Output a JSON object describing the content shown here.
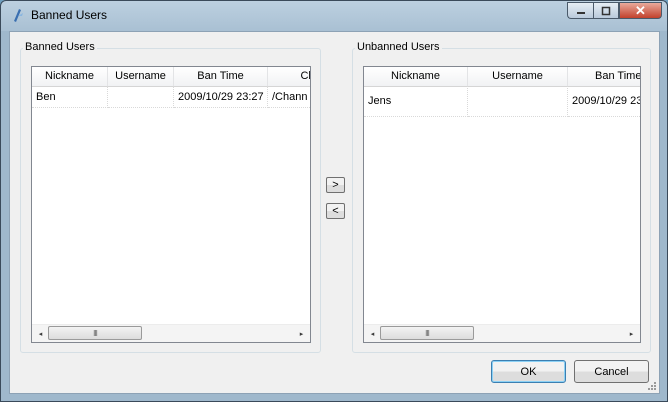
{
  "window": {
    "title": "Banned Users",
    "controls": {
      "minimize": "–",
      "maximize": "□",
      "close": "✕"
    }
  },
  "banned": {
    "group_label": "Banned Users",
    "columns": [
      "Nickname",
      "Username",
      "Ban Time",
      "Ch"
    ],
    "rows": [
      {
        "nickname": "Ben",
        "username": "",
        "ban_time": "2009/10/29 23:27",
        "channel": "/Chann"
      }
    ],
    "scroll_left": "◂",
    "scroll_right": "▸",
    "thumb_grip": "III"
  },
  "unbanned": {
    "group_label": "Unbanned Users",
    "columns": [
      "Nickname",
      "Username",
      "Ban Time"
    ],
    "rows": [
      {
        "nickname": "Jens",
        "username": "",
        "ban_time": "2009/10/29 23"
      }
    ],
    "scroll_left": "◂",
    "scroll_right": "▸",
    "thumb_grip": "III"
  },
  "move": {
    "unban_label": ">",
    "ban_label": "<"
  },
  "buttons": {
    "ok": "OK",
    "cancel": "Cancel"
  }
}
